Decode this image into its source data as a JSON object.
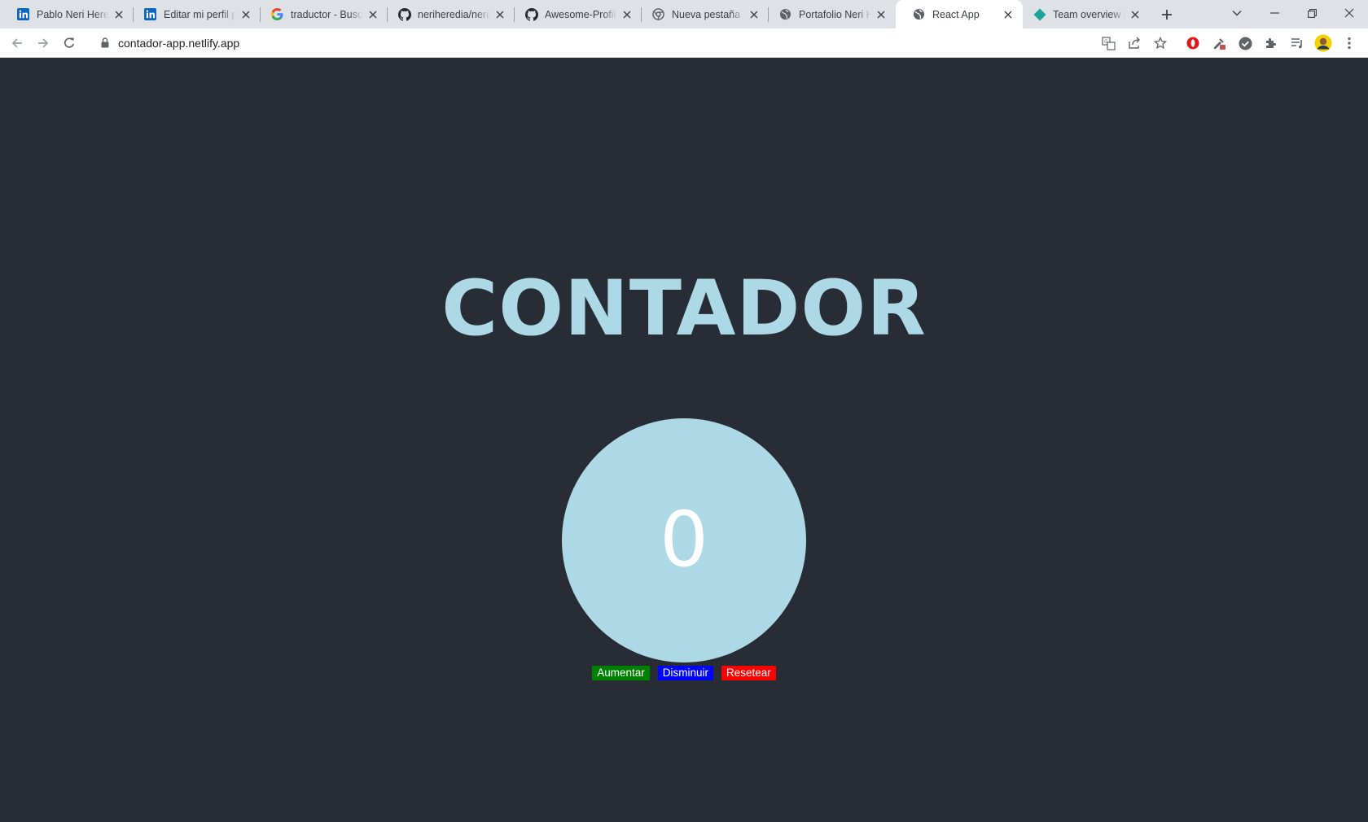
{
  "browser": {
    "tabs": [
      {
        "title": "Pablo Neri Heredia",
        "icon": "linkedin-icon",
        "active": false
      },
      {
        "title": "Editar mi perfil público",
        "icon": "linkedin-icon",
        "active": false
      },
      {
        "title": "traductor - Buscar con Google",
        "icon": "google-icon",
        "active": false
      },
      {
        "title": "neriheredia/neriheredia",
        "icon": "github-icon",
        "active": false
      },
      {
        "title": "Awesome-Profile-README",
        "icon": "github-icon",
        "active": false
      },
      {
        "title": "Nueva pestaña",
        "icon": "chrome-icon",
        "active": false
      },
      {
        "title": "Portafolio Neri Heredia",
        "icon": "globe-icon",
        "active": false
      },
      {
        "title": "React App",
        "icon": "globe-icon",
        "active": true
      },
      {
        "title": "Team overview | Team",
        "icon": "diamond-icon",
        "active": false
      }
    ],
    "url": "contador-app.netlify.app",
    "accent": "#add8e6"
  },
  "app": {
    "heading": "CONTADOR",
    "count": "0",
    "buttons": {
      "increase": "Aumentar",
      "decrease": "Disminuir",
      "reset": "Resetear"
    },
    "colors": {
      "background": "#282c34",
      "circle": "#add8e6",
      "increase": "#008000",
      "decrease": "#0000ff",
      "reset": "#ff0000"
    }
  }
}
